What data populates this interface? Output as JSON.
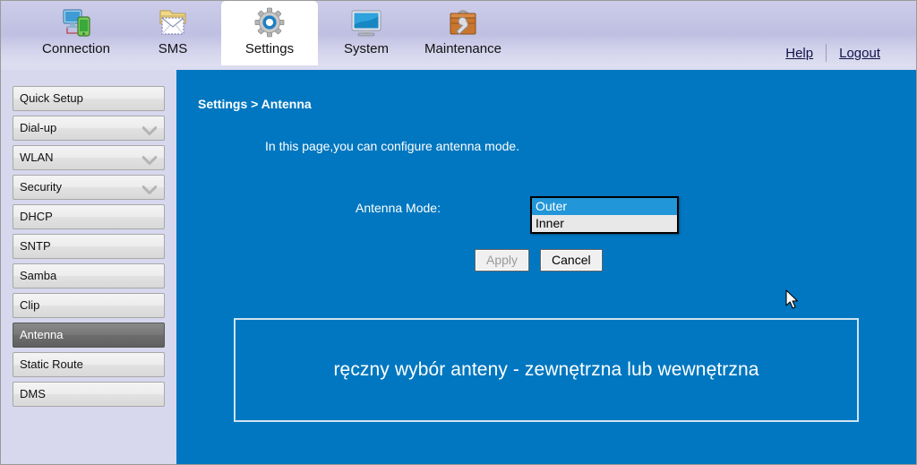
{
  "header": {
    "tabs": [
      {
        "label": "Connection",
        "icon": "connection-icon",
        "active": false
      },
      {
        "label": "SMS",
        "icon": "sms-envelope-icon",
        "active": false
      },
      {
        "label": "Settings",
        "icon": "gear-icon",
        "active": true
      },
      {
        "label": "System",
        "icon": "monitor-icon",
        "active": false
      },
      {
        "label": "Maintenance",
        "icon": "toolbox-icon",
        "active": false
      }
    ],
    "help_label": "Help",
    "logout_label": "Logout"
  },
  "sidebar": {
    "items": [
      {
        "label": "Quick Setup",
        "expandable": false,
        "selected": false
      },
      {
        "label": "Dial-up",
        "expandable": true,
        "selected": false
      },
      {
        "label": "WLAN",
        "expandable": true,
        "selected": false
      },
      {
        "label": "Security",
        "expandable": true,
        "selected": false
      },
      {
        "label": "DHCP",
        "expandable": false,
        "selected": false
      },
      {
        "label": "SNTP",
        "expandable": false,
        "selected": false
      },
      {
        "label": "Samba",
        "expandable": false,
        "selected": false
      },
      {
        "label": "Clip",
        "expandable": false,
        "selected": false
      },
      {
        "label": "Antenna",
        "expandable": false,
        "selected": true
      },
      {
        "label": "Static Route",
        "expandable": false,
        "selected": false
      },
      {
        "label": "DMS",
        "expandable": false,
        "selected": false
      }
    ]
  },
  "main": {
    "breadcrumb": "Settings > Antenna",
    "description": "In this page,you can configure antenna mode.",
    "antenna_mode": {
      "label": "Antenna Mode:",
      "selected": "Outer",
      "options": [
        "Outer",
        "Inner"
      ]
    },
    "apply_label": "Apply",
    "cancel_label": "Cancel",
    "annotation": "ręczny wybór anteny - zewnętrzna lub wewnętrzna"
  },
  "colors": {
    "content_blue": "#0077c0",
    "sidebar_lavender": "#d7d7ed",
    "highlight_blue": "#2196d9",
    "selected_menu_gray": "#6d6d6d"
  }
}
